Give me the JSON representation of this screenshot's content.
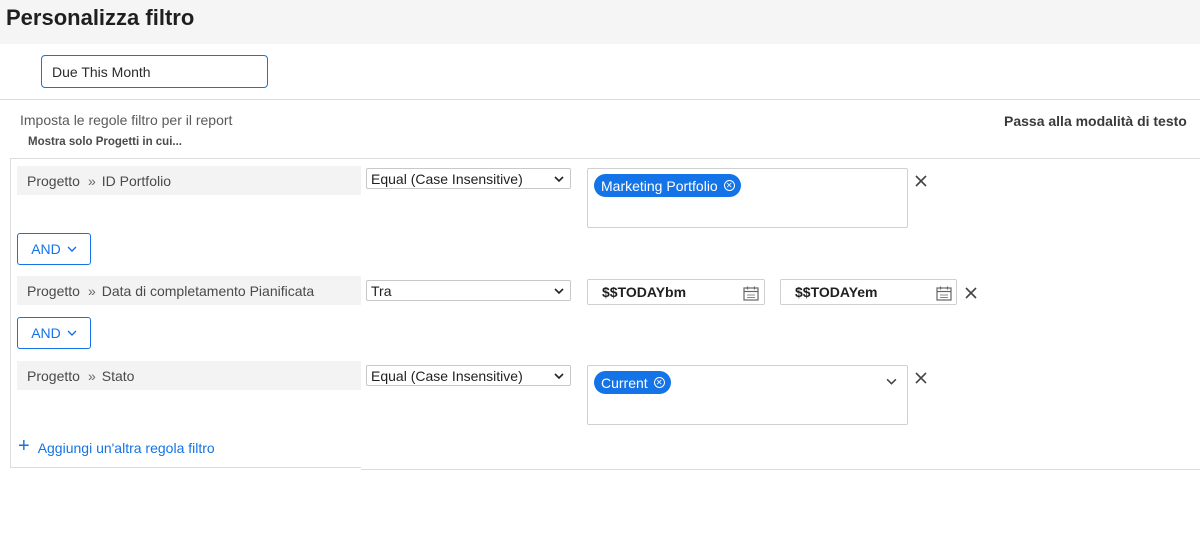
{
  "header": {
    "title": "Personalizza filtro"
  },
  "filter_name": {
    "value": "Due This Month"
  },
  "instructions": "Imposta le regole filtro per il report",
  "show_only": "Mostra solo Progetti in cui...",
  "switch_mode": "Passa alla modalità di testo",
  "rules": [
    {
      "object": "Progetto",
      "field": "ID Portfolio",
      "operator": "Equal (Case Insensitive)",
      "value_pill": "Marketing Portfolio"
    },
    {
      "object": "Progetto",
      "field": "Data di completamento Pianificata",
      "operator": "Tra",
      "date_start": "$$TODAYbm",
      "date_end": "$$TODAYem"
    },
    {
      "object": "Progetto",
      "field": "Stato",
      "operator": "Equal (Case Insensitive)",
      "value_pill": "Current"
    }
  ],
  "connectors": [
    "AND",
    "AND"
  ],
  "add_rule": {
    "icon": "+",
    "label": "Aggiungi un'altra regola filtro"
  },
  "colors": {
    "accent": "#1473e6",
    "field_bg": "#f3f3f3",
    "header_bg": "#f5f5f5"
  },
  "icons": {
    "breadcrumb_separator": "double-chevron-right-icon",
    "dropdown": "chevron-down-icon",
    "remove": "close-icon",
    "calendar": "calendar-icon",
    "pill_remove": "circle-x-icon",
    "add": "plus-icon"
  }
}
